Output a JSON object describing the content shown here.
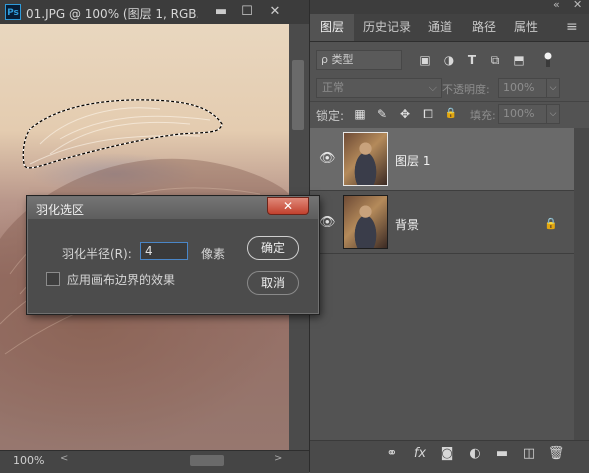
{
  "document": {
    "app_icon": "Ps",
    "title": "01.JPG @ 100% (图层 1, RGB...",
    "minimize_glyph": "▬",
    "maximize_glyph": "☐",
    "close_glyph": "✕",
    "zoom": "100%",
    "scroll_left_glyph": "<",
    "scroll_right_glyph": ">"
  },
  "dialog": {
    "title": "羽化选区",
    "close_glyph": "✕",
    "radius_label": "羽化半径(R):",
    "radius_value": "4",
    "radius_unit": "像素",
    "checkbox_label": "应用画布边界的效果",
    "checkbox_checked": false,
    "ok_label": "确定",
    "cancel_label": "取消"
  },
  "panel": {
    "collapse_glyph": "«",
    "close_glyph": "✕",
    "tabs": [
      {
        "label": "图层",
        "active": true
      },
      {
        "label": "历史记录",
        "active": false
      },
      {
        "label": "通道",
        "active": false
      },
      {
        "label": "路径",
        "active": false
      },
      {
        "label": "属性",
        "active": false
      }
    ],
    "menu_glyph": "≡",
    "filter": {
      "search_glyph": "ρ",
      "label": "类型"
    },
    "filter_icons": [
      "image-filter-icon",
      "adjustment-filter-icon",
      "type-filter-icon",
      "shape-filter-icon",
      "smart-object-filter-icon"
    ],
    "filter_icon_glyphs": [
      "▣",
      "◑",
      "T",
      "⧉",
      "⬒"
    ],
    "blend_mode": "正常",
    "opacity_label": "不透明度:",
    "opacity_value": "100%",
    "lock_label": "锁定:",
    "lock_glyphs": [
      "▦",
      "✎",
      "✥",
      "⧠",
      "🔒"
    ],
    "fill_label": "填充:",
    "fill_value": "100%",
    "dropdown_glyph": "⌵",
    "layers": [
      {
        "name": "图层 1",
        "visible": true,
        "selected": true,
        "locked": false
      },
      {
        "name": "背景",
        "visible": true,
        "selected": false,
        "locked": true
      }
    ],
    "eye_glyph": "👁",
    "lock_glyph": "🔒",
    "bottom_glyphs": [
      "⚭",
      "fx",
      "◙",
      "◐",
      "▬",
      "◫",
      "🗑"
    ]
  },
  "colors": {
    "panel_bg": "#535353",
    "selected_layer": "#6a6a6a",
    "accent_blue": "#4a86c7",
    "close_red": "#c2412e"
  }
}
